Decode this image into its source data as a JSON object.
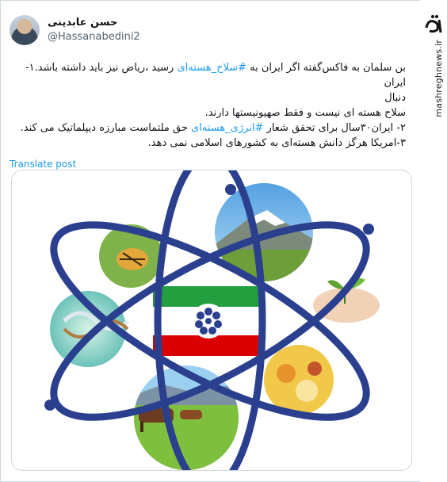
{
  "author": {
    "display_name": "حسن عابدینی",
    "handle": "@Hassanabedini2"
  },
  "tweet": {
    "line1_before": "بن سلمان به فاکس‌گفته اگر ایران به ",
    "hashtag1": "#سلاح_هسته‌ای",
    "line1_after": " رسید ،ریاض نیز باید داشته باشد.۱-ایران",
    "line2": "دنبال",
    "line3": "سلاح هسته ای نیست و فقط صهیونیستها دارند.",
    "line4_before": "۲- ایران۳۰سال برای تحقق شعار ",
    "hashtag2": "#انرژی_هسته‌ای",
    "line4_after": " حق ملتماست مبارزه دیپلماتیک می کند.",
    "line5": "۳-امریکا هرگز دانش هسته‌ای به کشورهای اسلامی نمی دهد."
  },
  "translate_label": "Translate post",
  "watermark": {
    "logo_text": "مشرق",
    "site": "mashreghnews.ir"
  },
  "media": {
    "description_icon": "iran-nuclear-energy-atom-emblem",
    "colors": {
      "orbit": "#2b3f8f",
      "flag_green": "#239f40",
      "flag_white": "#ffffff",
      "flag_red": "#da0000",
      "sky": "#6fb3e6"
    }
  }
}
